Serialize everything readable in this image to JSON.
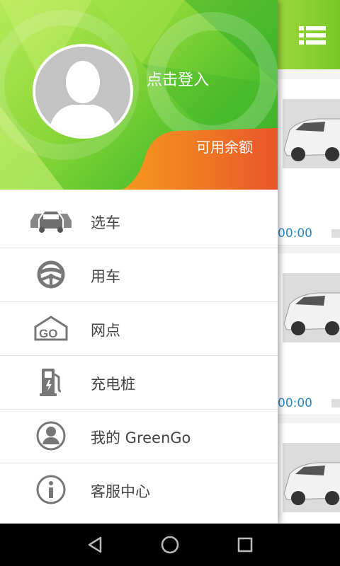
{
  "drawer": {
    "header": {
      "login_text": "点击登入",
      "balance_label": "可用余额"
    },
    "menu": [
      {
        "label": "选车",
        "icon": "cars-icon"
      },
      {
        "label": "用车",
        "icon": "steering-wheel-icon"
      },
      {
        "label": "网点",
        "icon": "station-location-icon"
      },
      {
        "label": "充电桩",
        "icon": "charging-pile-icon"
      },
      {
        "label": "我的 GreenGo",
        "icon": "user-profile-icon"
      },
      {
        "label": "客服中心",
        "icon": "info-icon"
      }
    ]
  },
  "background_app": {
    "menu_icon": "list-menu-icon",
    "cards": [
      {
        "time": "00:00"
      },
      {
        "time": "00:00"
      },
      {
        "time": ""
      }
    ]
  },
  "navbar": {
    "back": "back-icon",
    "home": "home-icon",
    "recents": "recents-icon"
  },
  "colors": {
    "header_green": "#8ad638",
    "balance_orange": "#f07a1f",
    "time_blue": "#2a86c8",
    "icon_gray": "#777777"
  }
}
